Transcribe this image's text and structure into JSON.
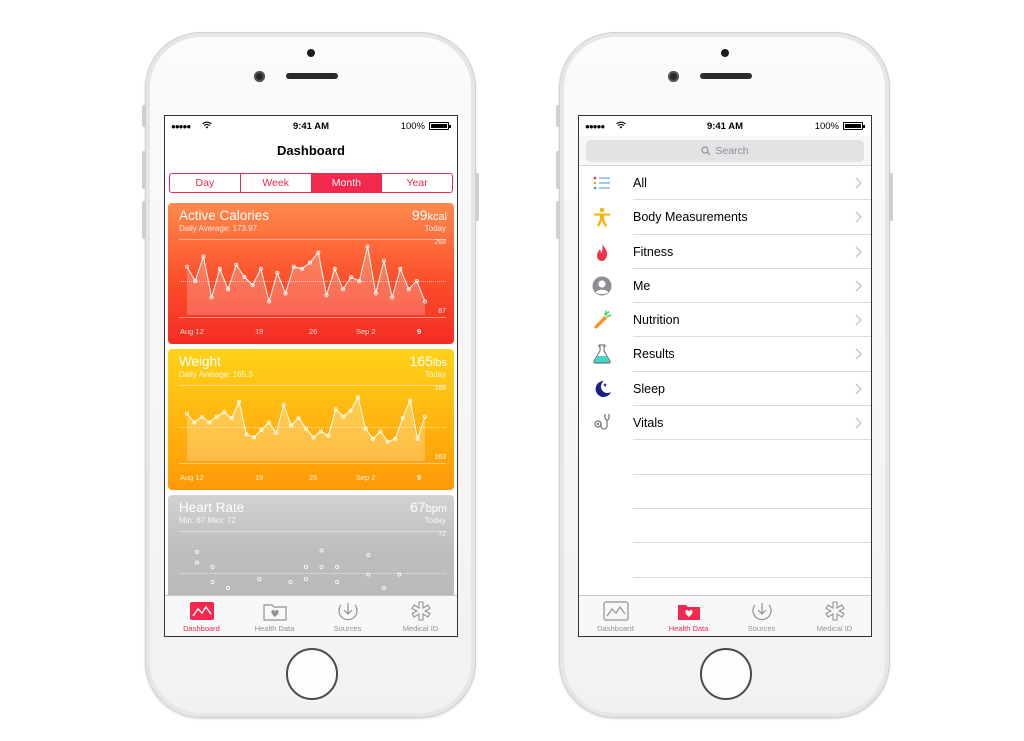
{
  "colors": {
    "accent": "#f2284e",
    "calories_top": "#ff8a4c",
    "calories_bottom": "#f42c23",
    "weight_top": "#ffd21a",
    "weight_bottom": "#ff9806",
    "heart_bg": "#bdbdbd",
    "tab_inactive": "#929292"
  },
  "left_phone": {
    "status": {
      "signal": "●●●●●",
      "time": "9:41 AM",
      "battery_pct": "100%",
      "battery_level": 1.0
    },
    "title": "Dashboard",
    "segments": [
      {
        "label": "Day",
        "active": false
      },
      {
        "label": "Week",
        "active": false
      },
      {
        "label": "Month",
        "active": true
      },
      {
        "label": "Year",
        "active": false
      }
    ],
    "cards": {
      "calories": {
        "name": "Active Calories",
        "sub": "Daily Average: 173.97",
        "value": "99",
        "unit": "kcal",
        "period": "Today",
        "max": "268",
        "min": "87",
        "x_labels": [
          "Aug 12",
          "19",
          "26",
          "Sep 2",
          "9"
        ],
        "series": [
          205,
          170,
          230,
          130,
          200,
          150,
          210,
          180,
          160,
          200,
          120,
          190,
          140,
          205,
          200,
          215,
          240,
          135,
          200,
          150,
          180,
          170,
          255,
          140,
          220,
          130,
          200,
          150,
          170,
          120
        ]
      },
      "weight": {
        "name": "Weight",
        "sub": "Daily Average: 165.3",
        "value": "165",
        "unit": "lbs",
        "period": "Today",
        "max": "168",
        "min": "163",
        "x_labels": [
          "Aug 12",
          "19",
          "26",
          "Sep 2",
          "9"
        ],
        "series": [
          166.2,
          165.6,
          166.0,
          165.6,
          166.0,
          166.3,
          165.9,
          167.0,
          164.8,
          164.6,
          165.1,
          165.6,
          164.9,
          166.8,
          165.4,
          165.9,
          165.2,
          164.6,
          165.0,
          164.7,
          166.5,
          166.0,
          166.4,
          167.3,
          165.2,
          164.5,
          165.0,
          164.3,
          164.5,
          165.9,
          167.1,
          164.5,
          166.0
        ]
      },
      "heart": {
        "name": "Heart Rate",
        "sub": "Min: 67  Max: 72",
        "value": "67",
        "unit": "bpm",
        "period": "Today",
        "max": "72",
        "series": [
          [
            71.0,
            70.3
          ],
          [
            70.0,
            69.0
          ],
          [
            68.6,
            68.0
          ],
          [
            68.0,
            67.2
          ],
          [
            69.2
          ],
          [
            68.0,
            67.2
          ],
          [
            69.0,
            68.0
          ],
          [
            70.0,
            69.2
          ],
          [
            71.1,
            70.0
          ],
          [
            70.0,
            69.0
          ],
          [
            68.0,
            67.2
          ],
          [
            70.8,
            69.5
          ],
          [
            68.6,
            67.2
          ],
          [
            69.5,
            68.0
          ],
          [
            67.4
          ]
        ]
      }
    },
    "tabs": [
      {
        "label": "Dashboard",
        "icon": "dashboard-icon",
        "active": true
      },
      {
        "label": "Health Data",
        "icon": "health-data-icon",
        "active": false
      },
      {
        "label": "Sources",
        "icon": "sources-icon",
        "active": false
      },
      {
        "label": "Medical ID",
        "icon": "medical-id-icon",
        "active": false
      }
    ]
  },
  "right_phone": {
    "status": {
      "signal": "●●●●●",
      "time": "9:41 AM",
      "battery_pct": "100%",
      "battery_level": 1.0
    },
    "search": {
      "placeholder": "Search"
    },
    "categories": [
      {
        "label": "All",
        "icon": "list-icon"
      },
      {
        "label": "Body Measurements",
        "icon": "body-figure-icon"
      },
      {
        "label": "Fitness",
        "icon": "flame-icon"
      },
      {
        "label": "Me",
        "icon": "person-icon"
      },
      {
        "label": "Nutrition",
        "icon": "carrot-icon"
      },
      {
        "label": "Results",
        "icon": "flask-icon"
      },
      {
        "label": "Sleep",
        "icon": "moon-icon"
      },
      {
        "label": "Vitals",
        "icon": "stethoscope-icon"
      }
    ],
    "tabs": [
      {
        "label": "Dashboard",
        "icon": "dashboard-icon",
        "active": false
      },
      {
        "label": "Health Data",
        "icon": "health-data-icon",
        "active": true
      },
      {
        "label": "Sources",
        "icon": "sources-icon",
        "active": false
      },
      {
        "label": "Medical ID",
        "icon": "medical-id-icon",
        "active": false
      }
    ]
  }
}
